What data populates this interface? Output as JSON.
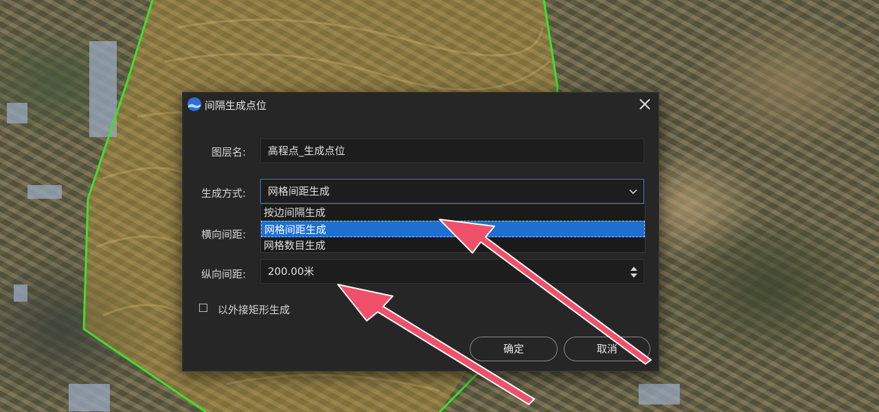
{
  "dialog": {
    "title": "间隔生成点位",
    "fields": {
      "layer_name_label": "图层名:",
      "layer_name_value": "高程点_生成点位",
      "method_label": "生成方式:",
      "method_value": "网格间距生成",
      "horizontal_spacing_label": "横向间距:",
      "vertical_spacing_label": "纵向间距:",
      "vertical_spacing_value": "200.00米"
    },
    "dropdown": {
      "options": [
        "按边间隔生成",
        "网格间距生成",
        "网格数目生成"
      ],
      "selected": "网格间距生成"
    },
    "checkbox": {
      "label": "以外接矩形生成",
      "checked": false
    },
    "buttons": {
      "confirm": "确定",
      "cancel": "取消"
    }
  },
  "colors": {
    "boundary": "#3fe02a",
    "highlight_region": "#c8a03c",
    "selection": "#1f6fd1",
    "arrow": "#f0506a",
    "dialog_bg": "#262626"
  }
}
